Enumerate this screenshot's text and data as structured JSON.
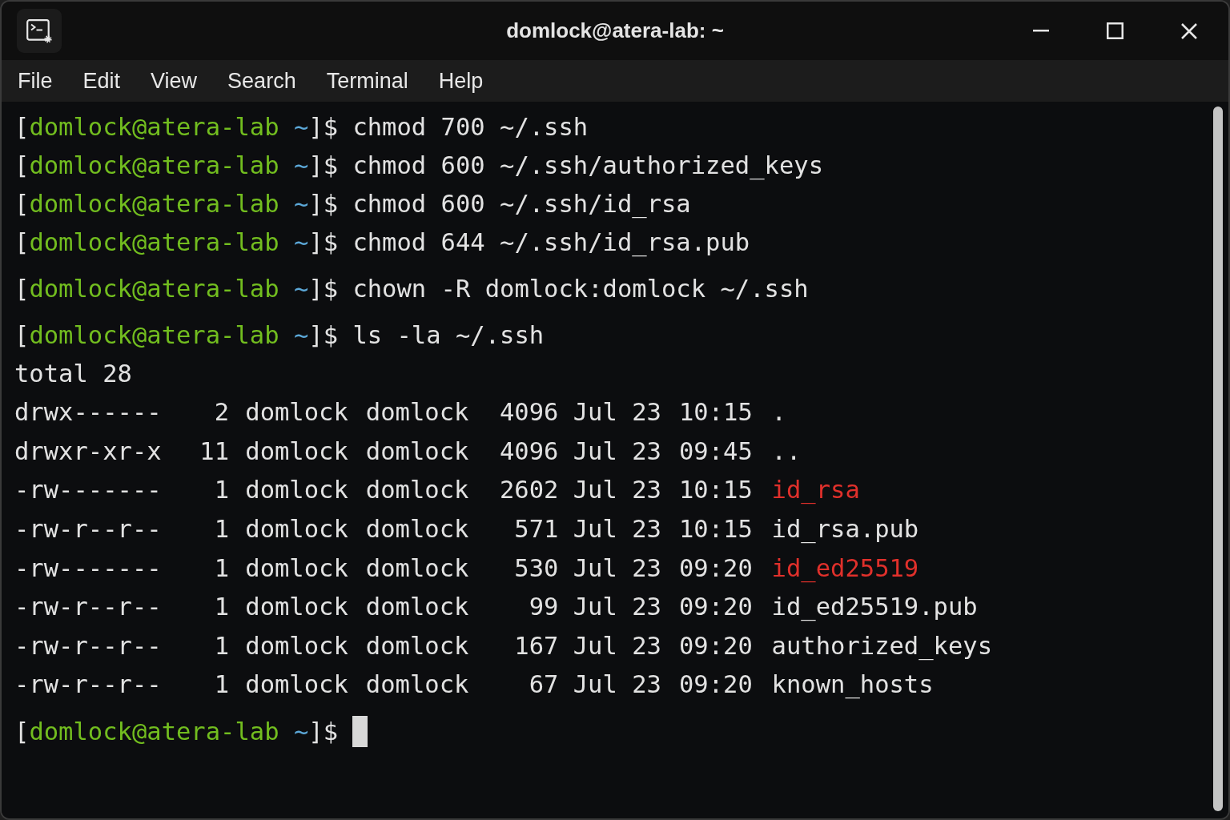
{
  "window": {
    "title": "domlock@atera-lab: ~"
  },
  "menu": [
    "File",
    "Edit",
    "View",
    "Search",
    "Terminal",
    "Help"
  ],
  "terminal": {
    "blocks": [
      {
        "lines": [
          {
            "kind": "prompt",
            "open": "[",
            "user_host": "domlock@atera-lab",
            "cwd": "~",
            "close": "]$",
            "command": "chmod 700 ~/.ssh"
          },
          {
            "kind": "prompt",
            "open": "[",
            "user_host": "domlock@atera-lab",
            "cwd": "~",
            "close": "]$",
            "command": "chmod 600 ~/.ssh/authorized_keys"
          },
          {
            "kind": "prompt",
            "open": "[",
            "user_host": "domlock@atera-lab",
            "cwd": "~",
            "close": "]$",
            "command": "chmod 600 ~/.ssh/id_rsa"
          },
          {
            "kind": "prompt",
            "open": "[",
            "user_host": "domlock@atera-lab",
            "cwd": "~",
            "close": "]$",
            "command": "chmod 644 ~/.ssh/id_rsa.pub"
          }
        ]
      },
      {
        "lines": [
          {
            "kind": "prompt",
            "open": "[",
            "user_host": "domlock@atera-lab",
            "cwd": "~",
            "close": "]$",
            "command": "chown -R domlock:domlock ~/.ssh"
          }
        ]
      },
      {
        "lines": [
          {
            "kind": "prompt",
            "open": "[",
            "user_host": "domlock@atera-lab",
            "cwd": "~",
            "close": "]$",
            "command": "ls -la ~/.ssh"
          },
          {
            "kind": "text",
            "text": "total 28"
          },
          {
            "kind": "listing",
            "permissions": "drwx------",
            "links": "2",
            "owner": "domlock",
            "group": "domlock",
            "size": "4096",
            "date": "Jul 23",
            "time": "10:15",
            "name": ".",
            "color": "#e2e2e2"
          },
          {
            "kind": "listing",
            "permissions": "drwxr-xr-x",
            "links": "11",
            "owner": "domlock",
            "group": "domlock",
            "size": "4096",
            "date": "Jul 23",
            "time": "09:45",
            "name": "..",
            "color": "#e2e2e2"
          },
          {
            "kind": "listing",
            "permissions": "-rw-------",
            "links": "1",
            "owner": "domlock",
            "group": "domlock",
            "size": "2602",
            "date": "Jul 23",
            "time": "10:15",
            "name": "id_rsa",
            "color": "#e0302b"
          },
          {
            "kind": "listing",
            "permissions": "-rw-r--r--",
            "links": "1",
            "owner": "domlock",
            "group": "domlock",
            "size": "571",
            "date": "Jul 23",
            "time": "10:15",
            "name": "id_rsa.pub",
            "color": "#e2e2e2"
          },
          {
            "kind": "listing",
            "permissions": "-rw-------",
            "links": "1",
            "owner": "domlock",
            "group": "domlock",
            "size": "530",
            "date": "Jul 23",
            "time": "09:20",
            "name": "id_ed25519",
            "color": "#e0302b"
          },
          {
            "kind": "listing",
            "permissions": "-rw-r--r--",
            "links": "1",
            "owner": "domlock",
            "group": "domlock",
            "size": "99",
            "date": "Jul 23",
            "time": "09:20",
            "name": "id_ed25519.pub",
            "color": "#e2e2e2"
          },
          {
            "kind": "listing",
            "permissions": "-rw-r--r--",
            "links": "1",
            "owner": "domlock",
            "group": "domlock",
            "size": "167",
            "date": "Jul 23",
            "time": "09:20",
            "name": "authorized_keys",
            "color": "#e2e2e2"
          },
          {
            "kind": "listing",
            "permissions": "-rw-r--r--",
            "links": "1",
            "owner": "domlock",
            "group": "domlock",
            "size": "67",
            "date": "Jul 23",
            "time": "09:20",
            "name": "known_hosts",
            "color": "#e2e2e2"
          }
        ]
      },
      {
        "lines": [
          {
            "kind": "prompt",
            "open": "[",
            "user_host": "domlock@atera-lab",
            "cwd": "~",
            "close": "]$",
            "cursor": true
          }
        ]
      }
    ]
  }
}
